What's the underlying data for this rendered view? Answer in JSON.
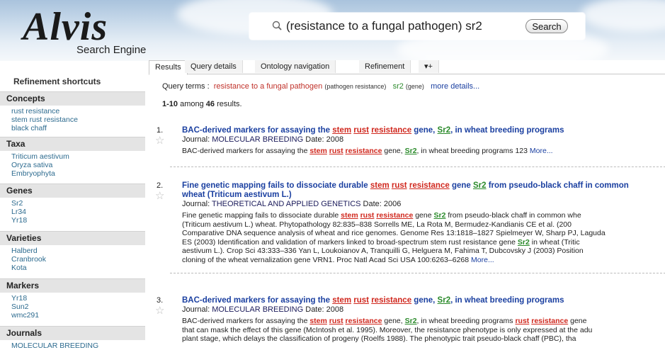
{
  "header": {
    "logo_mark": "Alvis",
    "logo_sub": "Search Engine",
    "search_value": "(resistance to a fungal pathogen) sr2",
    "search_button": "Search"
  },
  "tabs": [
    {
      "label": "Results"
    },
    {
      "label": "Query details"
    },
    {
      "label": "Ontology navigation"
    },
    {
      "label": "Refinement"
    },
    {
      "label": "▾+"
    }
  ],
  "sidebar": {
    "title": "Refinement shortcuts",
    "sections": [
      {
        "head": "Concepts",
        "items": [
          "rust resistance",
          "stem rust resistance",
          "black chaff"
        ]
      },
      {
        "head": "Taxa",
        "items": [
          "Triticum aestivum",
          "Oryza sativa",
          "Embryophyta"
        ]
      },
      {
        "head": "Genes",
        "items": [
          "Sr2",
          "Lr34",
          "Yr18"
        ]
      },
      {
        "head": "Varieties",
        "items": [
          "Halberd",
          "Cranbrook",
          "Kota"
        ]
      },
      {
        "head": "Markers",
        "items": [
          "Yr18",
          "Sun2",
          "wmc291"
        ]
      },
      {
        "head": "Journals",
        "items": [
          "MOLECULAR BREEDING"
        ]
      }
    ]
  },
  "query": {
    "label": "Query terms :",
    "term1": "resistance to a fungal pathogen",
    "term1_cat": "(pathogen resistance)",
    "term2": "sr2",
    "term2_cat": "(gene)",
    "more_details": "more details..."
  },
  "counts": {
    "range": "1-10",
    "among": "among",
    "total": "46",
    "suffix": "results."
  },
  "results": [
    {
      "num": "1.",
      "journal_label": "Journal:",
      "journal": "MOLECULAR BREEDING",
      "date_label": "Date:",
      "date": "2008",
      "title": [
        "BAC-derived markers for assaying the ",
        "stem",
        " ",
        "rust",
        " ",
        "resistance",
        " gene, ",
        "Sr2",
        ", in wheat breeding programs"
      ],
      "snippet": [
        "BAC-derived markers for assaying the ",
        "stem",
        " ",
        "rust",
        " ",
        "resistance",
        " gene, ",
        "Sr2",
        ", in wheat breeding programs 123 "
      ],
      "more": "More..."
    },
    {
      "num": "2.",
      "journal_label": "Journal:",
      "journal": "THEORETICAL AND APPLIED GENETICS",
      "date_label": "Date:",
      "date": "2006",
      "title_line1": [
        "Fine genetic mapping fails to dissociate durable ",
        "stem",
        " ",
        "rust",
        " ",
        "resistance",
        " gene ",
        "Sr2",
        " from pseudo-black chaff in common"
      ],
      "title_line2": "wheat (Triticum aestivum L.)",
      "snippet_line1": [
        "Fine genetic mapping fails to dissociate durable ",
        "stem",
        " ",
        "rust",
        " ",
        "resistance",
        " gene ",
        "Sr2",
        " from pseudo-black chaff in common whe"
      ],
      "snippet_line2": "(Triticum aestivum L.) wheat. Phytopathology 82:835–838 Sorrells ME, La Rota M, Bermudez-Kandianis CE et al. (200",
      "snippet_line3": "Comparative DNA sequence analysis of wheat and rice genomes. Genome Res 13:1818–1827 Spielmeyer W, Sharp PJ, Laguda",
      "snippet_line4a": "ES (2003) Identification and validation of markers linked to broad-spectrum stem rust resistance gene ",
      "snippet_line4_gene": "Sr2",
      "snippet_line4b": " in wheat (Tritic",
      "snippet_line5": "aestivum L.). Crop Sci 43:333–336 Yan L, Loukoianov A, Tranquilli G, Helguera M, Fahima T, Dubcovsky J (2003) Position",
      "snippet_line6": "cloning of the wheat vernalization gene VRN1. Proc Natl Acad Sci USA 100:6263–6268 ",
      "more": "More..."
    },
    {
      "num": "3.",
      "journal_label": "Journal:",
      "journal": "MOLECULAR BREEDING",
      "date_label": "Date:",
      "date": "2008",
      "title": [
        "BAC-derived markers for assaying the ",
        "stem",
        " ",
        "rust",
        " ",
        "resistance",
        " gene, ",
        "Sr2",
        ", in wheat breeding programs"
      ],
      "snippet_line1": [
        "BAC-derived markers for assaying the ",
        "stem",
        " ",
        "rust",
        " ",
        "resistance",
        " gene, ",
        "Sr2",
        ", in wheat breeding programs ",
        "rust",
        " ",
        "resistance",
        " gene"
      ],
      "snippet_line2": "that can mask the effect of this gene (McIntosh et al. 1995). Moreover, the resistance phenotype is only expressed at the adu",
      "snippet_line3": "plant stage, which delays the classification of progeny (Roelfs 1988). The phenotypic trait pseudo-black chaff (PBC), tha"
    }
  ],
  "colors": {
    "title_blue": "#1a3fa0",
    "highlight_red": "#d0281e",
    "highlight_green": "#2a8a2a",
    "sidebar_link": "#2d6b8f"
  },
  "icons": {
    "search": "magnifier-icon",
    "star": "star-icon"
  }
}
